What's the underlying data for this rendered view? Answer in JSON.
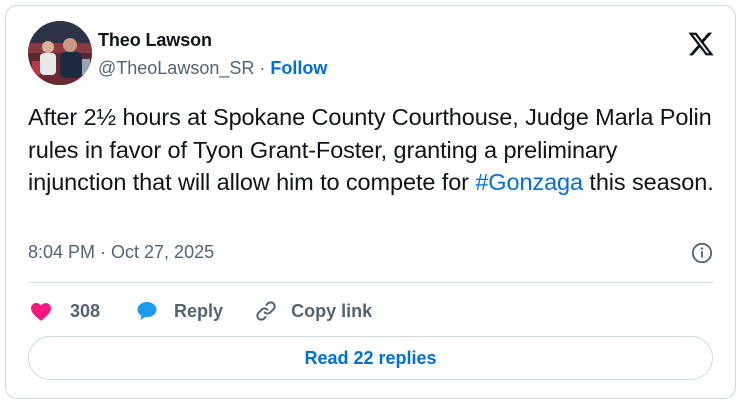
{
  "author": {
    "name": "Theo Lawson",
    "handle": "@TheoLawson_SR",
    "separator": "·",
    "follow_label": "Follow"
  },
  "tweet": {
    "text_before": "After 2½ hours at Spokane County Courthouse, Judge Marla Polin rules in favor of Tyon Grant-Foster, granting a preliminary injunction that will allow him to compete for ",
    "hashtag": "#Gonzaga",
    "text_after": " this season.",
    "timestamp": "8:04 PM · Oct 27, 2025"
  },
  "actions": {
    "like_count": "308",
    "reply_label": "Reply",
    "copy_label": "Copy link"
  },
  "replies_button": "Read 22 replies",
  "colors": {
    "accent": "#006fd6",
    "like": "#f91880",
    "reply_icon": "#1d9bf0",
    "muted": "#536471",
    "border": "#cfd9de"
  },
  "icons": [
    "x-logo-icon",
    "info-icon",
    "heart-icon",
    "reply-bubble-icon",
    "link-icon"
  ]
}
